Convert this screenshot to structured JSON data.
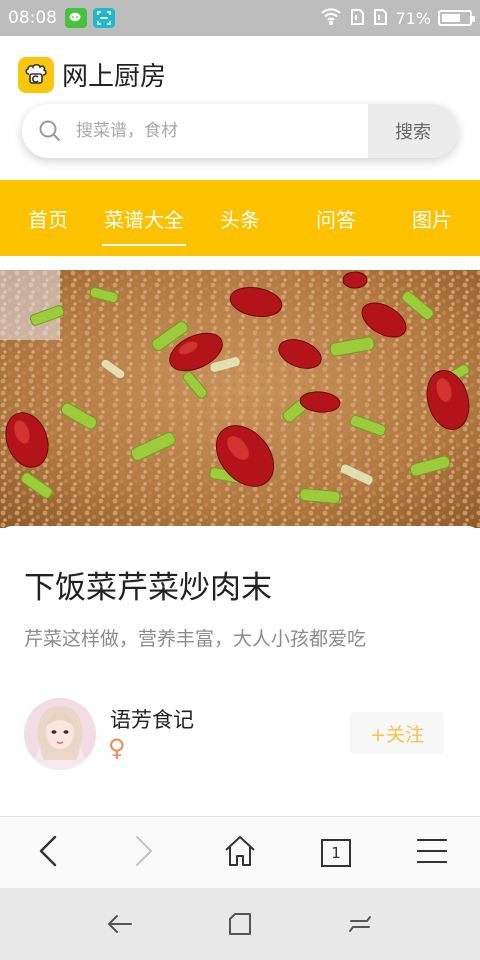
{
  "status_bar": {
    "time": "08:08",
    "battery_percent": "71%",
    "battery_level": 0.71,
    "icons": [
      "wechat-icon",
      "scan-icon",
      "wifi-icon",
      "signal-icon",
      "signal-icon-2",
      "battery-icon"
    ]
  },
  "header": {
    "app_name": "网上厨房",
    "logo_icon": "chef-logo-icon",
    "search": {
      "placeholder": "搜菜谱，食材",
      "value": "",
      "button_label": "搜索"
    }
  },
  "nav": {
    "tabs": [
      {
        "label": "首页",
        "active": false
      },
      {
        "label": "菜谱大全",
        "active": true
      },
      {
        "label": "头条",
        "active": false
      },
      {
        "label": "问答",
        "active": false
      },
      {
        "label": "图片",
        "active": false
      }
    ]
  },
  "recipe": {
    "title": "下饭菜芹菜炒肉末",
    "description": "芹菜这样做，营养丰富，大人小孩都爱吃",
    "author": {
      "name": "语芳食记",
      "gender_symbol": "♀",
      "follow_label": "+关注"
    }
  },
  "browser_toolbar": {
    "tab_count": "1",
    "icons": [
      "back-icon",
      "forward-icon",
      "home-icon",
      "tabs-icon",
      "menu-icon"
    ]
  },
  "system_nav": {
    "icons": [
      "system-back-icon",
      "recent-apps-icon",
      "system-menu-icon"
    ]
  },
  "colors": {
    "accent_yellow": "#fcc200",
    "follow_text": "#f6c24a",
    "gender": "#f08a57"
  }
}
